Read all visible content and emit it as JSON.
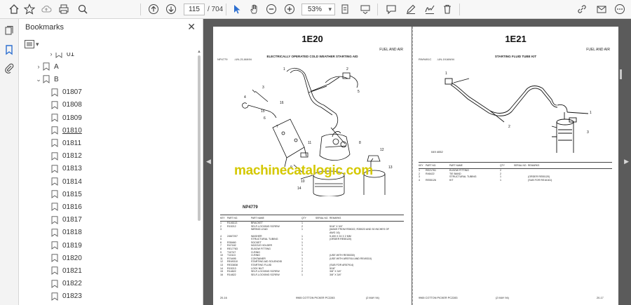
{
  "toolbar": {
    "page_current": "115",
    "page_total": "/ 704",
    "zoom": "53%",
    "icons": [
      "home-icon",
      "bookmark-star-icon",
      "cloud-upload-icon",
      "print-icon",
      "zoom-search-icon",
      "page-up-icon",
      "page-down-icon",
      "select-cursor-icon",
      "hand-tool-icon",
      "zoom-out-icon",
      "zoom-in-icon",
      "fit-page-icon",
      "keyboard-scroll-icon",
      "comment-icon",
      "pen-icon",
      "signature-icon",
      "delete-icon",
      "link-icon",
      "mail-icon",
      "more-icon"
    ]
  },
  "rail": {
    "icons": [
      "pages-icon",
      "bookmark-icon",
      "attachment-icon"
    ]
  },
  "bookmarks": {
    "title": "Bookmarks",
    "tree": [
      {
        "label": "01",
        "level": 0,
        "chevron": "collapsed",
        "partial": true
      },
      {
        "label": "A",
        "level": 1,
        "chevron": "collapsed"
      },
      {
        "label": "B",
        "level": 1,
        "chevron": "expanded"
      },
      {
        "label": "01807",
        "level": 2
      },
      {
        "label": "01808",
        "level": 2
      },
      {
        "label": "01809",
        "level": 2
      },
      {
        "label": "01810",
        "level": 2,
        "underlined": true
      },
      {
        "label": "01811",
        "level": 2
      },
      {
        "label": "01812",
        "level": 2
      },
      {
        "label": "01813",
        "level": 2
      },
      {
        "label": "01814",
        "level": 2
      },
      {
        "label": "01815",
        "level": 2
      },
      {
        "label": "01816",
        "level": 2
      },
      {
        "label": "01817",
        "level": 2
      },
      {
        "label": "01818",
        "level": 2
      },
      {
        "label": "01819",
        "level": 2
      },
      {
        "label": "01820",
        "level": 2
      },
      {
        "label": "01821",
        "level": 2
      },
      {
        "label": "01822",
        "level": 2
      },
      {
        "label": "01823",
        "level": 2
      }
    ]
  },
  "document": {
    "watermark": "machinecatalogic.com",
    "left_page": {
      "number": "1E20",
      "section": "FUEL AND AIR",
      "subtitle": "ELECTRICALLY OPERATED COLD WEATHER STARTING AID",
      "top_left": "NP4779",
      "top_left_2": "-UN-21JAN94",
      "figure_code": "NP4779",
      "table_headers": [
        "KEY",
        "PART NO.",
        "PART NAME",
        "QTY",
        "SERIAL NO.",
        "REMARKS"
      ],
      "rows": [
        [
          "1",
          "R146113",
          "BRACKET",
          "1",
          "",
          ""
        ],
        [
          "2",
          "R15212",
          "SELF-LOCKING SCREW",
          "2",
          "",
          "5/16\" X 3/4\""
        ],
        [
          "3",
          "",
          "WIRING LEAD",
          "1",
          "",
          "(MAKE FROM R35022, R35023 AND 30 INCHES OF"
        ],
        [
          "",
          "",
          "",
          "",
          "",
          "AWG 16)"
        ],
        [
          "4",
          "24M7207",
          "WASHER",
          "1",
          "",
          "5.400 X 24 X 2 MM"
        ],
        [
          "5",
          "",
          "STRUCTURAL TUBING",
          "1",
          "",
          "(ORDER RE55120)"
        ],
        [
          "6",
          "R35460",
          "SOCKET",
          "1",
          "",
          ""
        ],
        [
          "7",
          "R47182",
          "NOZZLE HOLDER",
          "1",
          "",
          ""
        ],
        [
          "8",
          "RE17783",
          "ELBOW FITTING",
          "1",
          "",
          ""
        ],
        [
          "9",
          "T10747",
          "O-RING",
          "1",
          "",
          ""
        ],
        [
          "10",
          "T13113",
          "O-RING",
          "1",
          "",
          "(USE WITH RE55330)"
        ],
        [
          "11",
          "R74495",
          "CONTAINER",
          "1",
          "",
          "(USE WITH AR57914 AND RE49310)"
        ],
        [
          "12",
          "RE49310",
          "STARTING AID SOLENOID",
          "1",
          "",
          ""
        ],
        [
          "13",
          "RE33838",
          "STARTING FLUID",
          "1",
          "",
          "(SUB FOR AR57914)"
        ],
        [
          "14",
          "R15213",
          "LOCK NUT",
          "1",
          "",
          "5/16\""
        ],
        [
          "15",
          "R14822",
          "SELF-LOCKING SCREW",
          "2",
          "",
          "3/8\" X 3/4\""
        ],
        [
          "16",
          "R14822",
          "SELF-LOCKING SCREW",
          "1",
          "",
          "3/8\" X 3/4\""
        ]
      ],
      "footer_left": "20-16",
      "footer_center": "9965 COTTON PICKER  PC2283",
      "footer_right": "(2 MAY 94)"
    },
    "right_page": {
      "number": "1E21",
      "section": "FUEL AND AIR",
      "subtitle": "STARTING FLUID TUBE KIT",
      "top_left": "RW9491C",
      "top_left_2": "-UN-19JAN94",
      "table_headers": [
        "KEY",
        "PART NO.",
        "PART NAME",
        "QTY",
        "SERIAL NO.",
        "REMARKS"
      ],
      "rows": [
        [
          "1",
          "RE21761",
          "ELBOW FITTING",
          "2",
          "",
          ""
        ],
        [
          "2",
          "R46422",
          "TIE BAND",
          "2",
          "",
          ""
        ],
        [
          "3",
          "",
          "STRUCTURAL TUBING",
          "1",
          "",
          "(ORDER RE55120)"
        ],
        [
          "4",
          "RE55126",
          "KIT",
          "1",
          "",
          "(SUB FOR RE16161)"
        ]
      ],
      "footer_left": "9965 COTTON PICKER  PC2283",
      "footer_center": "(2 MAY 94)",
      "footer_right": "20-17"
    }
  }
}
